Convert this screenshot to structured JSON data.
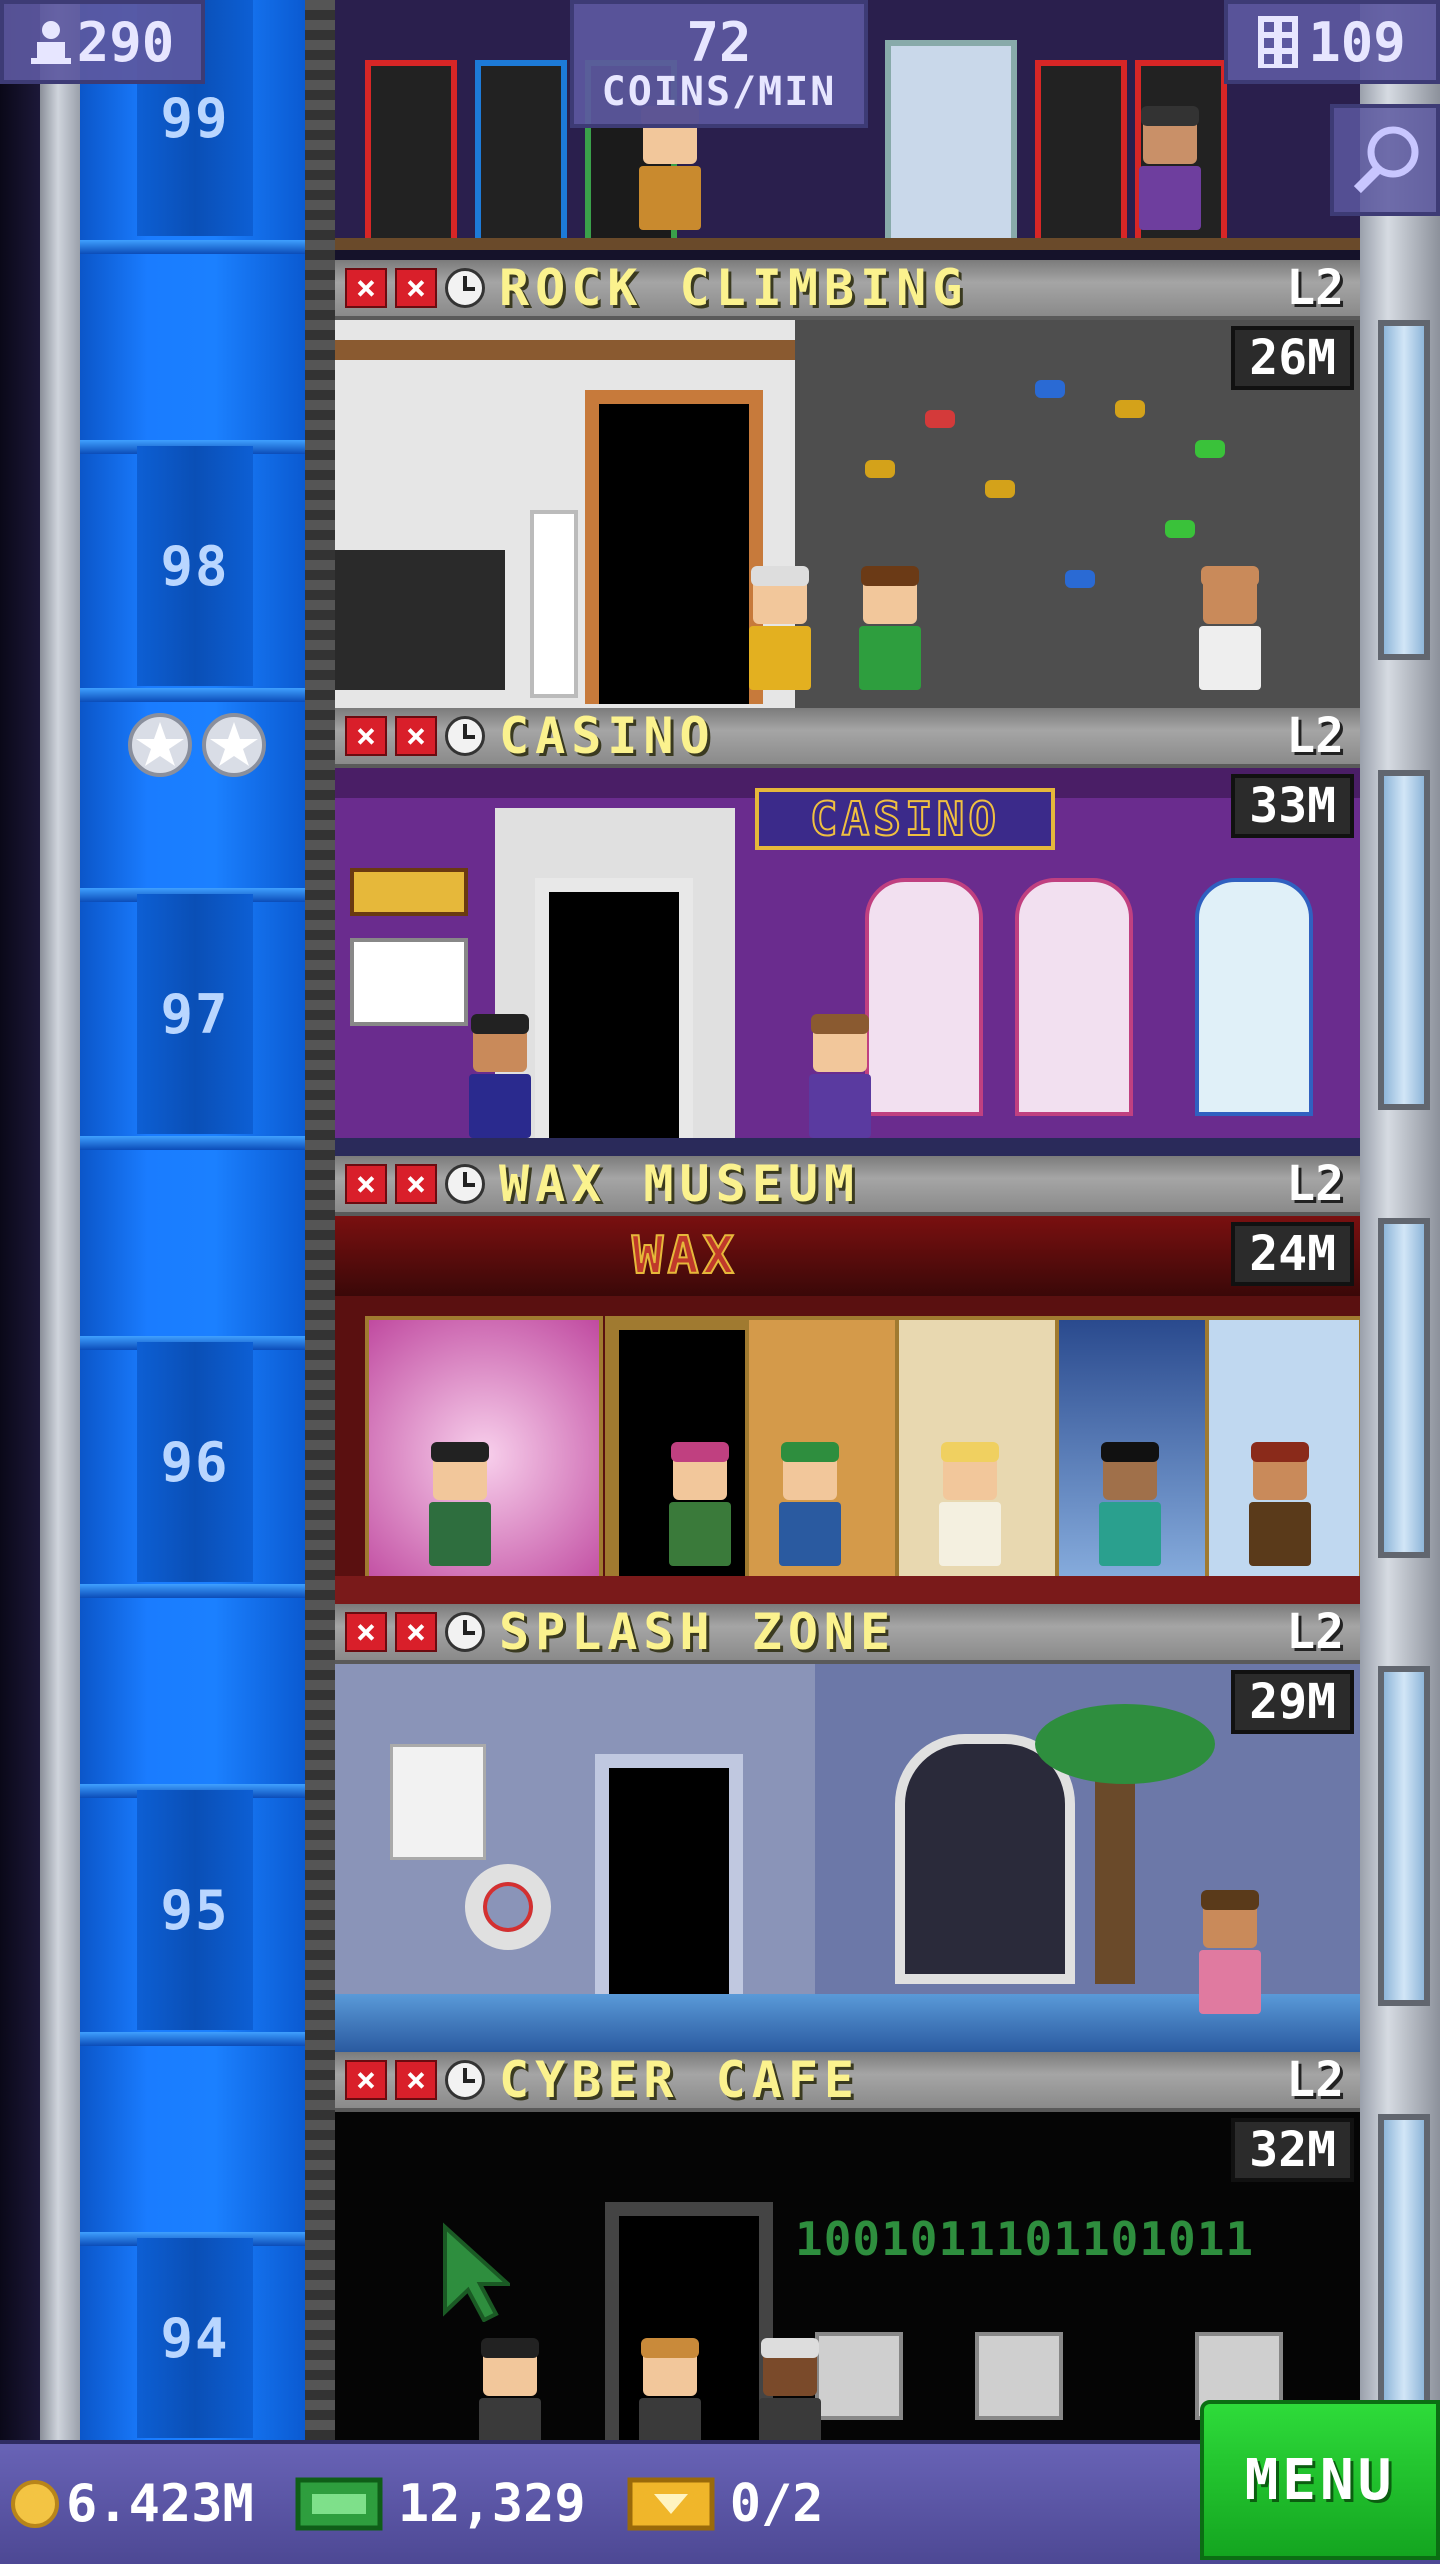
{
  "hud": {
    "population": "290",
    "coins_rate_value": "72",
    "coins_rate_unit": "COINS/MIN",
    "floors_count": "109"
  },
  "elevator": {
    "floor_numbers": [
      "99",
      "98",
      "97",
      "96",
      "95",
      "94"
    ]
  },
  "floors": [
    {
      "name": "ROCK CLIMBING",
      "level": "L2",
      "earnings": "26M"
    },
    {
      "name": "CASINO",
      "level": "L2",
      "earnings": "33M",
      "sign": "CASINO"
    },
    {
      "name": "WAX MUSEUM",
      "level": "L2",
      "earnings": "24M",
      "sign": "WAX"
    },
    {
      "name": "SPLASH ZONE",
      "level": "L2",
      "earnings": "29M"
    },
    {
      "name": "CYBER CAFE",
      "level": "L2",
      "earnings": "32M",
      "binary": "1001011101101011"
    }
  ],
  "bottom_bar": {
    "coins": "6.423M",
    "bux": "12,329",
    "tickets": "0/2",
    "menu_label": "MENU"
  },
  "colors": {
    "elevator_blue": "#1a7cff",
    "menu_green": "#22c22e",
    "hud_purple": "#5c58a0",
    "floor_name_yellow": "#fbf28e",
    "stock_x_red": "#d91f2a"
  }
}
